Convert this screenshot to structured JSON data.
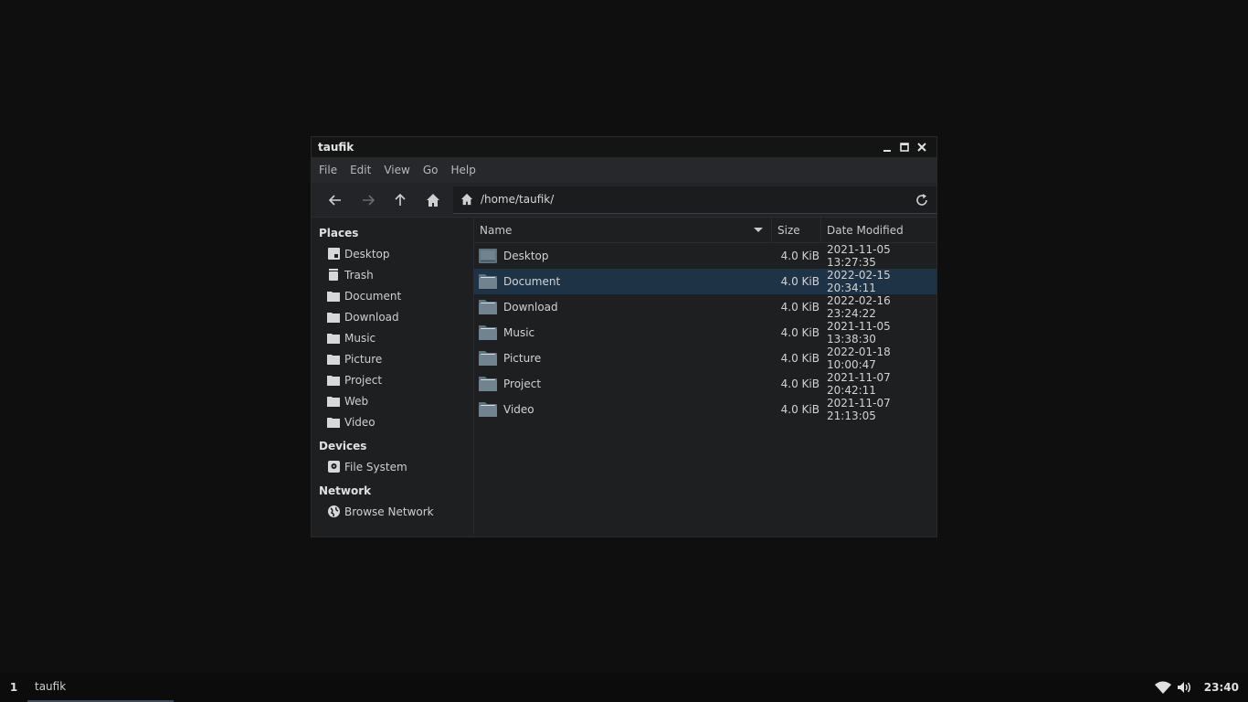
{
  "window": {
    "title": "taufik",
    "menu": [
      "File",
      "Edit",
      "View",
      "Go",
      "Help"
    ],
    "location": "/home/taufik/"
  },
  "sidebar": {
    "places_title": "Places",
    "places": [
      {
        "label": "Desktop",
        "icon": "desktop-icon"
      },
      {
        "label": "Trash",
        "icon": "trash-icon"
      },
      {
        "label": "Document",
        "icon": "folder-icon"
      },
      {
        "label": "Download",
        "icon": "folder-icon"
      },
      {
        "label": "Music",
        "icon": "folder-icon"
      },
      {
        "label": "Picture",
        "icon": "folder-icon"
      },
      {
        "label": "Project",
        "icon": "folder-icon"
      },
      {
        "label": "Web",
        "icon": "folder-icon"
      },
      {
        "label": "Video",
        "icon": "folder-icon"
      }
    ],
    "devices_title": "Devices",
    "devices": [
      {
        "label": "File System",
        "icon": "drive-icon"
      }
    ],
    "network_title": "Network",
    "network": [
      {
        "label": "Browse Network",
        "icon": "globe-icon"
      }
    ]
  },
  "columns": {
    "name": "Name",
    "size": "Size",
    "date": "Date Modified"
  },
  "files": [
    {
      "name": "Desktop",
      "size": "4.0 KiB",
      "date": "2021-11-05 13:27:35",
      "icon": "desktop-folder-icon"
    },
    {
      "name": "Document",
      "size": "4.0 KiB",
      "date": "2022-02-15 20:34:11",
      "icon": "folder-icon",
      "selected": true
    },
    {
      "name": "Download",
      "size": "4.0 KiB",
      "date": "2022-02-16 23:24:22",
      "icon": "folder-icon"
    },
    {
      "name": "Music",
      "size": "4.0 KiB",
      "date": "2021-11-05 13:38:30",
      "icon": "folder-icon"
    },
    {
      "name": "Picture",
      "size": "4.0 KiB",
      "date": "2022-01-18 10:00:47",
      "icon": "folder-icon"
    },
    {
      "name": "Project",
      "size": "4.0 KiB",
      "date": "2021-11-07 20:42:11",
      "icon": "folder-icon"
    },
    {
      "name": "Video",
      "size": "4.0 KiB",
      "date": "2021-11-07 21:13:05",
      "icon": "folder-icon"
    }
  ],
  "taskbar": {
    "workspace": "1",
    "task": "taufik",
    "clock": "23:40"
  },
  "colors": {
    "selection": "#1f3347",
    "folder": "#5f7280",
    "accent": "#3b4a5c"
  }
}
